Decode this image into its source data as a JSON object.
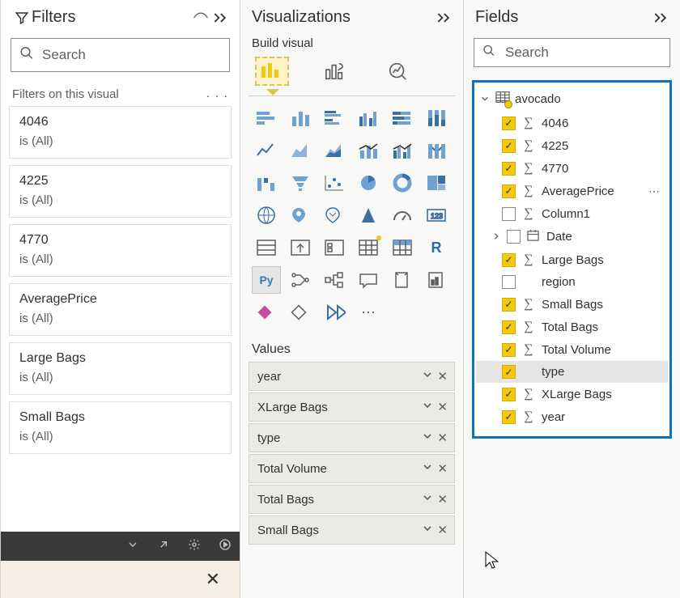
{
  "filters": {
    "title": "Filters",
    "search_placeholder": "Search",
    "section_label": "Filters on this visual",
    "cards": [
      {
        "name": "4046",
        "state": "is (All)"
      },
      {
        "name": "4225",
        "state": "is (All)"
      },
      {
        "name": "4770",
        "state": "is (All)"
      },
      {
        "name": "AveragePrice",
        "state": "is (All)"
      },
      {
        "name": "Large Bags",
        "state": "is (All)"
      },
      {
        "name": "Small Bags",
        "state": "is (All)"
      }
    ]
  },
  "viz": {
    "title": "Visualizations",
    "subtitle": "Build visual",
    "values_label": "Values",
    "wells": [
      {
        "name": "year"
      },
      {
        "name": "XLarge Bags"
      },
      {
        "name": "type"
      },
      {
        "name": "Total Volume"
      },
      {
        "name": "Total Bags"
      },
      {
        "name": "Small Bags"
      }
    ]
  },
  "fields": {
    "title": "Fields",
    "search_placeholder": "Search",
    "table": "avocado",
    "items": [
      {
        "name": "4046",
        "checked": true,
        "sigma": true
      },
      {
        "name": "4225",
        "checked": true,
        "sigma": true
      },
      {
        "name": "4770",
        "checked": true,
        "sigma": true
      },
      {
        "name": "AveragePrice",
        "checked": true,
        "sigma": true,
        "more": true
      },
      {
        "name": "Column1",
        "checked": false,
        "sigma": true
      },
      {
        "name": "Date",
        "checked": false,
        "calendar": true,
        "expandable": true
      },
      {
        "name": "Large Bags",
        "checked": true,
        "sigma": true
      },
      {
        "name": "region",
        "checked": false
      },
      {
        "name": "Small Bags",
        "checked": true,
        "sigma": true
      },
      {
        "name": "Total Bags",
        "checked": true,
        "sigma": true
      },
      {
        "name": "Total Volume",
        "checked": true,
        "sigma": true
      },
      {
        "name": "type",
        "checked": true,
        "selected": true
      },
      {
        "name": "XLarge Bags",
        "checked": true,
        "sigma": true
      },
      {
        "name": "year",
        "checked": true,
        "sigma": true
      }
    ]
  }
}
